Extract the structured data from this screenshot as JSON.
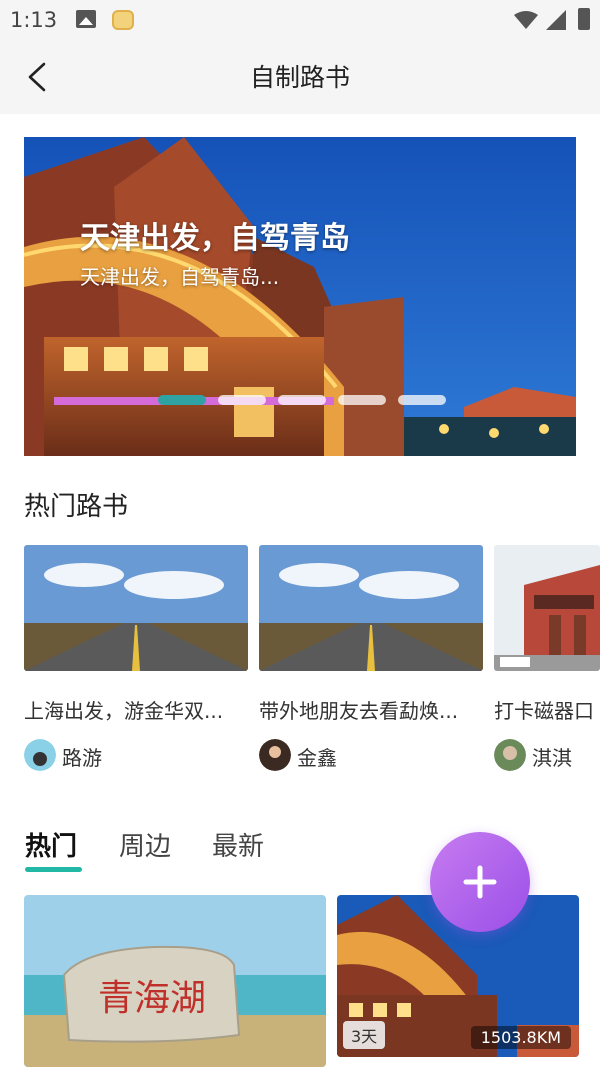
{
  "status_bar": {
    "time": "1:13"
  },
  "header": {
    "title": "自制路书"
  },
  "banner": {
    "title": "天津出发，自驾青岛",
    "subtitle": "天津出发，自驾青岛...",
    "pages": 5,
    "active_page": 1
  },
  "hot_section": {
    "title": "热门路书",
    "cards": [
      {
        "title": "上海出发，游金华双...",
        "user": "路游"
      },
      {
        "title": "带外地朋友去看勐焕...",
        "user": "金鑫"
      },
      {
        "title": "打卡磁器口",
        "user": "淇淇"
      }
    ]
  },
  "tabs": [
    {
      "label": "热门",
      "active": true
    },
    {
      "label": "周边",
      "active": false
    },
    {
      "label": "最新",
      "active": false
    }
  ],
  "grid": [
    {
      "image_text": "青海湖"
    },
    {
      "days": "3天",
      "distance": "1503.8KM"
    }
  ],
  "colors": {
    "accent": "#21b8a6",
    "fab": "#9a4fe8",
    "dot_active": "#2fa3a3"
  }
}
